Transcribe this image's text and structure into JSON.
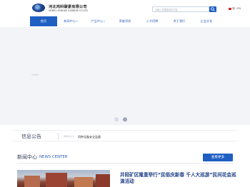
{
  "brand": {
    "name_cn": "河北鸿科碳素有限公司",
    "name_en": "HEBEI HONGKE CARBON CO.LTD"
  },
  "search": {
    "placeholder": "请输入您要搜索的内容"
  },
  "language": {
    "label": "简 / EN"
  },
  "nav": {
    "items": [
      {
        "label": "首页"
      },
      {
        "label": "新闻中心"
      },
      {
        "label": "产品中心"
      },
      {
        "label": "荣誉资质"
      },
      {
        "label": "人才招聘"
      },
      {
        "label": "关于我们"
      },
      {
        "label": "企业文化"
      }
    ]
  },
  "hero": {
    "tag": "1080P"
  },
  "notice": {
    "title": "信息公告",
    "date": "2023-1-1",
    "text": "同种设备安全监督"
  },
  "news": {
    "title_cn": "新闻中心",
    "title_en": "NEWS CENTER",
    "more_label": "查看更多",
    "headline": "井陉矿区隆重举行“民俗庆新春 千人大巡游”民间花会巡演活动"
  },
  "colors": {
    "accent": "#1f5fc2",
    "nav_text": "#3a67b8",
    "headline": "#1f3f86"
  }
}
